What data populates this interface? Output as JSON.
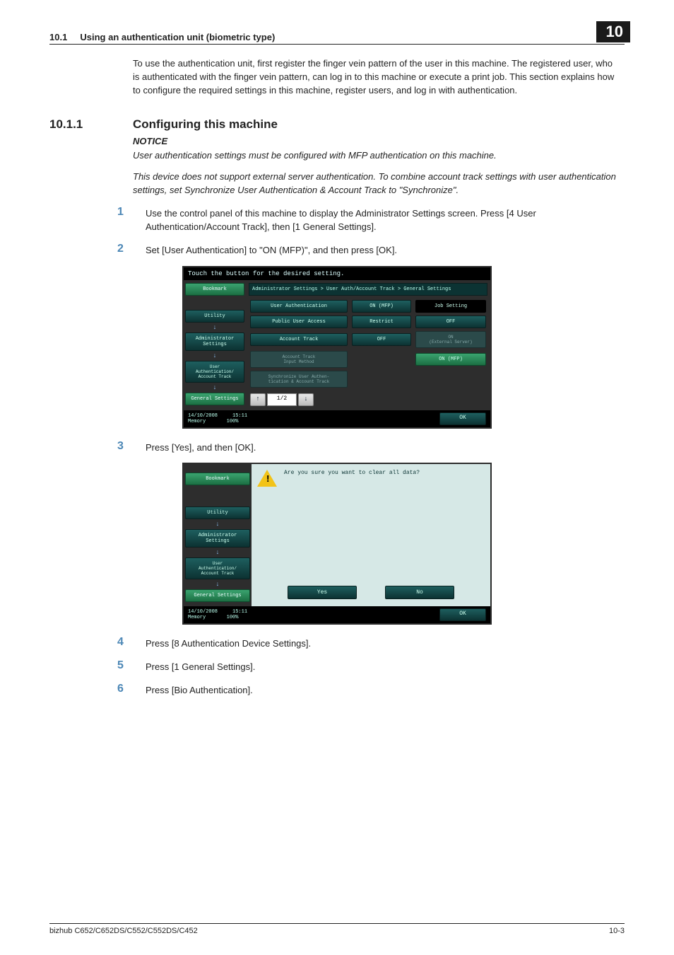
{
  "header": {
    "section_num": "10.1",
    "section_title": "Using an authentication unit (biometric type)",
    "chapter_box": "10"
  },
  "intro_paragraph": "To use the authentication unit, first register the finger vein pattern of the user in this machine. The registered user, who is authenticated with the finger vein pattern, can log in to this machine or execute a print job. This section explains how to configure the required settings in this machine, register users, and log in with authentication.",
  "subheading": {
    "num": "10.1.1",
    "title": "Configuring this machine"
  },
  "notice": {
    "label": "NOTICE",
    "line1": "User authentication settings must be configured with MFP authentication on this machine.",
    "line2": "This device does not support external server authentication. To combine account track settings with user authentication settings, set Synchronize User Authentication & Account Track to \"Synchronize\"."
  },
  "steps": {
    "s1": {
      "num": "1",
      "text": "Use the control panel of this machine to display the Administrator Settings screen. Press [4 User Authentication/Account Track], then [1 General Settings]."
    },
    "s2": {
      "num": "2",
      "text": "Set [User Authentication] to \"ON (MFP)\", and then press [OK]."
    },
    "s3": {
      "num": "3",
      "text": "Press [Yes], and then [OK]."
    },
    "s4": {
      "num": "4",
      "text": "Press [8 Authentication Device Settings]."
    },
    "s5": {
      "num": "5",
      "text": "Press [1 General Settings]."
    },
    "s6": {
      "num": "6",
      "text": "Press [Bio Authentication]."
    }
  },
  "mfp1": {
    "topbar": "Touch the button for the desired setting.",
    "sidebar": {
      "bookmark": "Bookmark",
      "utility": "Utility",
      "admin": "Administrator\nSettings",
      "userauth": "User\nAuthentication/\nAccount Track",
      "general": "General Settings"
    },
    "breadcrumb": "Administrator Settings > User Auth/Account Track  > General Settings",
    "rows": {
      "user_auth_label": "User Authentication",
      "user_auth_value": "ON (MFP)",
      "public_user_label": "Public User Access",
      "public_user_value": "Restrict",
      "account_track_label": "Account Track",
      "account_track_value": "OFF",
      "at_input_label": "Account Track\nInput Method",
      "sync_label": "Synchronize User Authen-\ntication & Account Track"
    },
    "right_col": {
      "job_setting": "Job Setting",
      "off": "OFF",
      "on_ext": "ON\n(External Server)",
      "on_mfp": "ON (MFP)"
    },
    "pager": {
      "up": "↑",
      "label": "1/2",
      "down": "↓"
    },
    "footer": {
      "date": "14/10/2008",
      "time": "15:11",
      "mem": "Memory",
      "mem_pct": "100%",
      "ok": "OK"
    }
  },
  "mfp2": {
    "sidebar": {
      "bookmark": "Bookmark",
      "utility": "Utility",
      "admin": "Administrator\nSettings",
      "userauth": "User\nAuthentication/\nAccount Track",
      "general": "General Settings"
    },
    "warn_text": "Are you sure you want to clear all data?",
    "yes": "Yes",
    "no": "No",
    "footer": {
      "date": "14/10/2008",
      "time": "15:11",
      "mem": "Memory",
      "mem_pct": "100%",
      "ok": "OK"
    }
  },
  "page_footer": {
    "left": "bizhub C652/C652DS/C552/C552DS/C452",
    "right": "10-3"
  }
}
